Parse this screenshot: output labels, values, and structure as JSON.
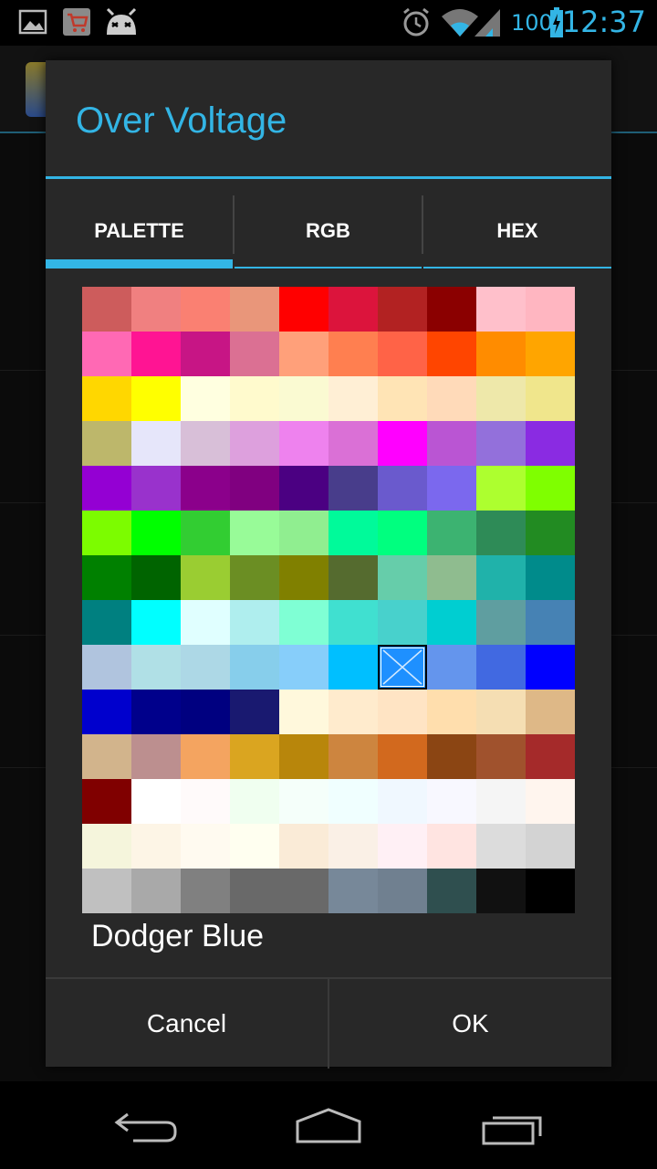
{
  "status_bar": {
    "icons": [
      "gallery-notification-icon",
      "shopping-cart-notification-icon",
      "android-robot-icon",
      "alarm-icon",
      "wifi-icon",
      "signal-icon"
    ],
    "battery": "100",
    "time": "12:37",
    "accent": "#33b5e5"
  },
  "dialog": {
    "title": "Over Voltage",
    "tabs": [
      {
        "label": "PALETTE",
        "active": true
      },
      {
        "label": "RGB",
        "active": false
      },
      {
        "label": "HEX",
        "active": false
      }
    ],
    "selected_color_name": "Dodger Blue",
    "selected_index": 86,
    "palette": [
      "#CD5C5C",
      "#F08080",
      "#FA8072",
      "#E9967A",
      "#FF0000",
      "#DC143C",
      "#B22222",
      "#8B0000",
      "#FFC0CB",
      "#FFB6C1",
      "#FF69B4",
      "#FF1493",
      "#C71585",
      "#DB7093",
      "#FFA07A",
      "#FF7F50",
      "#FF6347",
      "#FF4500",
      "#FF8C00",
      "#FFA500",
      "#FFD700",
      "#FFFF00",
      "#FFFFE0",
      "#FFFACD",
      "#FAFAD2",
      "#FFEFD5",
      "#FFE4B5",
      "#FFDAB9",
      "#EEE8AA",
      "#F0E68C",
      "#BDB76B",
      "#E6E6FA",
      "#D8BFD8",
      "#DDA0DD",
      "#EE82EE",
      "#DA70D6",
      "#FF00FF",
      "#BA55D3",
      "#9370DB",
      "#8A2BE2",
      "#9400D3",
      "#9932CC",
      "#8B008B",
      "#800080",
      "#4B0082",
      "#483D8B",
      "#6A5ACD",
      "#7B68EE",
      "#ADFF2F",
      "#7FFF00",
      "#7CFC00",
      "#00FF00",
      "#32CD32",
      "#98FB98",
      "#90EE90",
      "#00FA9A",
      "#00FF7F",
      "#3CB371",
      "#2E8B57",
      "#228B22",
      "#008000",
      "#006400",
      "#9ACD32",
      "#6B8E23",
      "#808000",
      "#556B2F",
      "#66CDAA",
      "#8FBC8F",
      "#20B2AA",
      "#008B8B",
      "#008080",
      "#00FFFF",
      "#E0FFFF",
      "#AFEEEE",
      "#7FFFD4",
      "#40E0D0",
      "#48D1CC",
      "#00CED1",
      "#5F9EA0",
      "#4682B4",
      "#B0C4DE",
      "#B0E0E6",
      "#ADD8E6",
      "#87CEEB",
      "#87CEFA",
      "#00BFFF",
      "#1E90FF",
      "#6495ED",
      "#4169E1",
      "#0000FF",
      "#0000CD",
      "#00008B",
      "#000080",
      "#191970",
      "#FFF8DC",
      "#FFEBCD",
      "#FFE4C4",
      "#FFDEAD",
      "#F5DEB3",
      "#DEB887",
      "#D2B48C",
      "#BC8F8F",
      "#F4A460",
      "#DAA520",
      "#B8860B",
      "#CD853F",
      "#D2691E",
      "#8B4513",
      "#A0522D",
      "#A52A2A",
      "#800000",
      "#FFFFFF",
      "#FFFAFA",
      "#F0FFF0",
      "#F5FFFA",
      "#F0FFFF",
      "#F0F8FF",
      "#F8F8FF",
      "#F5F5F5",
      "#FFF5EE",
      "#F5F5DC",
      "#FDF5E6",
      "#FFFAF0",
      "#FFFFF0",
      "#FAEBD7",
      "#FAF0E6",
      "#FFF0F5",
      "#FFE4E1",
      "#DCDCDC",
      "#D3D3D3",
      "#C0C0C0",
      "#A9A9A9",
      "#808080",
      "#696969",
      "#696969",
      "#778899",
      "#708090",
      "#2F4F4F",
      "#111111",
      "#000000"
    ],
    "cancel_label": "Cancel",
    "ok_label": "OK"
  },
  "nav_bar": {
    "buttons": [
      "back-icon",
      "home-icon",
      "recent-apps-icon"
    ]
  }
}
